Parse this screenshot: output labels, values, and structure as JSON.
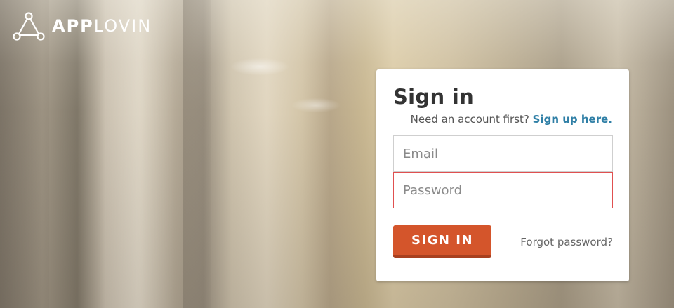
{
  "brand": {
    "name_bold": "APP",
    "name_light": "LOVIN",
    "icon": "applovin-triangle-icon"
  },
  "signin": {
    "title": "Sign in",
    "prompt": "Need an account first?",
    "signup_link": "Sign up here.",
    "email_placeholder": "Email",
    "email_value": "",
    "password_placeholder": "Password",
    "password_value": "",
    "submit_label": "SIGN IN",
    "forgot_link": "Forgot password?"
  },
  "colors": {
    "accent": "#d4552b",
    "link": "#2f7fa6",
    "error_border": "#e05050"
  }
}
